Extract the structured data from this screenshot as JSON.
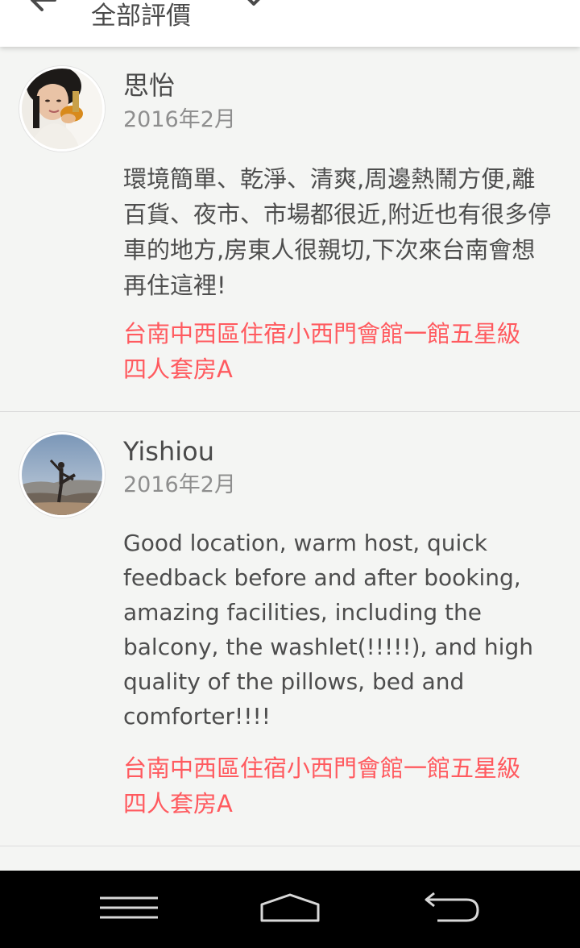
{
  "header": {
    "title": "全部評價"
  },
  "reviews": [
    {
      "reviewer": "思怡",
      "date": "2016年2月",
      "text": "環境簡單、乾淨、清爽,周邊熱鬧方便,離百貨、夜市、市場都很近,附近也有很多停車的地方,房東人很親切,下次來台南會想再住這裡!",
      "listing": "台南中西區住宿小西門會館一館五星級四人套房A"
    },
    {
      "reviewer": "Yishiou",
      "date": "2016年2月",
      "text": "Good location, warm host, quick feedback before and after booking, amazing facilities, including the balcony, the washlet(!!!!!), and high quality of the pillows, bed and comforter!!!!",
      "listing": "台南中西區住宿小西門會館一館五星級四人套房A"
    }
  ],
  "colors": {
    "accent": "#ff5a5f",
    "text_primary": "#4a4a4a",
    "text_secondary": "#8e8e8e",
    "background": "#f4f5f3",
    "navbar": "#000000"
  },
  "icons": {
    "back": "arrow-left-icon",
    "dropdown": "chevron-down-icon",
    "nav_menu": "menu-icon",
    "nav_home": "home-icon",
    "nav_back": "back-icon"
  }
}
